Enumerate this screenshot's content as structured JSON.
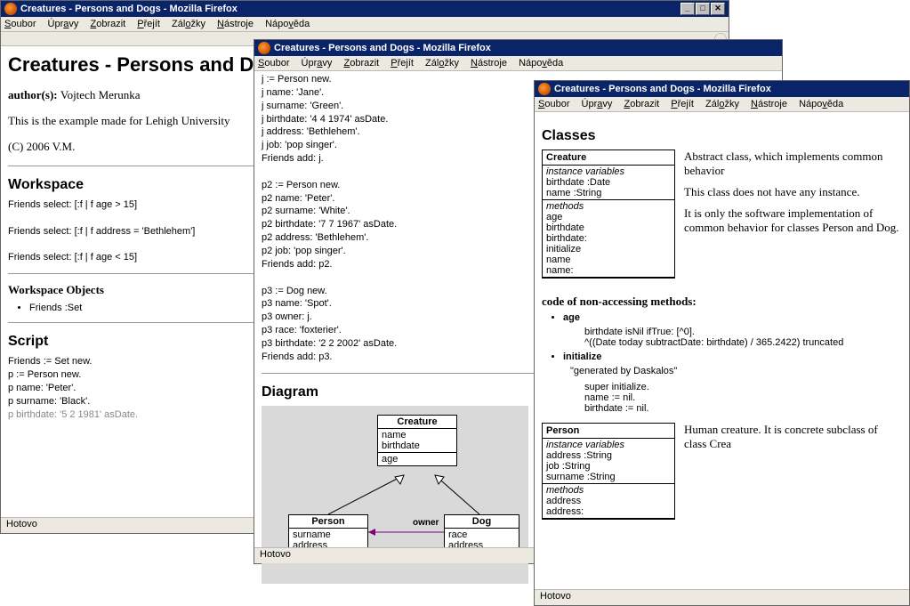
{
  "win1": {
    "title": "Creatures - Persons and Dogs - Mozilla Firefox",
    "menu": [
      "Soubor",
      "Úpravy",
      "Zobrazit",
      "Přejít",
      "Záložky",
      "Nástroje",
      "Nápověda"
    ],
    "status": "Hotovo",
    "page": {
      "title": "Creatures - Persons and Dogs",
      "author_label": "author(s): ",
      "author": "Vojtech Merunka",
      "desc": "This is the example made for Lehigh University",
      "copyright": "(C) 2006 V.M.",
      "workspace_h": "Workspace",
      "ws_lines": [
        "Friends select: [:f | f age > 15]",
        "Friends select: [:f | f address = 'Bethlehem']",
        "Friends select: [:f | f age < 15]"
      ],
      "ws_objects_h": "Workspace Objects",
      "ws_obj_items": [
        "Friends :Set"
      ],
      "script_h": "Script",
      "script_lines": [
        "Friends := Set new.",
        "",
        "p := Person new.",
        "p name: 'Peter'.",
        "p surname: 'Black'.",
        "p birthdate: '5 2 1981' asDate."
      ]
    }
  },
  "win2": {
    "title": "Creatures - Persons and Dogs - Mozilla Firefox",
    "menu": [
      "Soubor",
      "Úpravy",
      "Zobrazit",
      "Přejít",
      "Záložky",
      "Nástroje",
      "Nápověda"
    ],
    "status": "Hotovo",
    "script_lines": [
      "j := Person new.",
      "j name: 'Jane'.",
      "j surname: 'Green'.",
      "j birthdate: '4 4 1974' asDate.",
      "j address: 'Bethlehem'.",
      "j job: 'pop singer'.",
      "Friends add: j.",
      "",
      "p2 := Person new.",
      "p2 name: 'Peter'.",
      "p2 surname: 'White'.",
      "p2 birthdate: '7 7 1967' asDate.",
      "p2 address: 'Bethlehem'.",
      "p2 job: 'pop singer'.",
      "Friends add: p2.",
      "",
      "p3 := Dog new.",
      "p3 name: 'Spot'.",
      "p3 owner: j.",
      "p3 race: 'foxterier'.",
      "p3 birthdate: '2 2 2002' asDate.",
      "Friends add: p3."
    ],
    "diagram_h": "Diagram",
    "uml": {
      "creature": {
        "name": "Creature",
        "attrs": [
          "name",
          "birthdate"
        ],
        "ops": [
          "age"
        ]
      },
      "person": {
        "name": "Person",
        "attrs": [
          "surname",
          "address"
        ]
      },
      "dog": {
        "name": "Dog",
        "attrs": [
          "race",
          "address"
        ]
      },
      "assoc": "owner"
    }
  },
  "win3": {
    "title": "Creatures - Persons and Dogs - Mozilla Firefox",
    "menu": [
      "Soubor",
      "Úpravy",
      "Zobrazit",
      "Přejít",
      "Záložky",
      "Nástroje",
      "Nápověda"
    ],
    "status": "Hotovo",
    "classes_h": "Classes",
    "creature_box": {
      "name": "Creature",
      "iv_label": "instance variables",
      "ivs": [
        "birthdate :Date",
        "name :String"
      ],
      "m_label": "methods",
      "methods": [
        "age",
        "birthdate",
        "birthdate:",
        "initialize",
        "name",
        "name:"
      ]
    },
    "creature_desc": [
      "Abstract class, which implements common behavior",
      "This class does not have any instance.",
      "It is only the software implementation of common behavior for classes Person and Dog."
    ],
    "nonacc_h": "code of non-accessing methods:",
    "method_age": {
      "name": "age",
      "body": [
        "birthdate isNil ifTrue: [^0].",
        "^((Date today subtractDate: birthdate) / 365.2422) truncated"
      ]
    },
    "method_init": {
      "name": "initialize",
      "comment": "\"generated by Daskalos\"",
      "body": [
        "super initialize.",
        "name := nil.",
        "birthdate := nil."
      ]
    },
    "person_box": {
      "name": "Person",
      "iv_label": "instance variables",
      "ivs": [
        "address :String",
        "job :String",
        "surname :String"
      ],
      "m_label": "methods",
      "methods": [
        "address",
        "address:"
      ]
    },
    "person_desc": "Human creature. It is concrete subclass of class Crea"
  }
}
